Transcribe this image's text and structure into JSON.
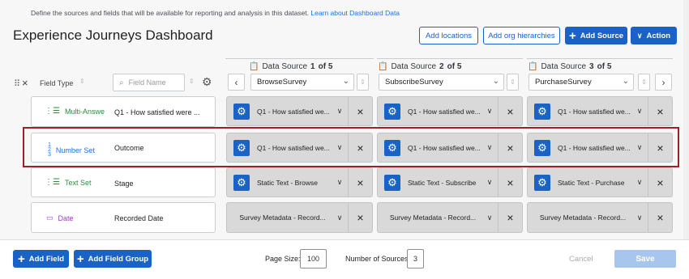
{
  "header": {
    "intro_text": "Define the sources and fields that will be available for reporting and analysis in this dataset.",
    "intro_link": "Learn about Dashboard Data",
    "title": "Experience Journeys Dashboard",
    "add_locations": "Add locations",
    "add_org_hierarchies": "Add org hierarchies",
    "add_source": "Add Source",
    "action": "Action"
  },
  "columns": {
    "field_type": "Field Type",
    "field_name_placeholder": "Field Name"
  },
  "sources": [
    {
      "label": "Data Source",
      "num": "1",
      "of": "of 5",
      "select": "BrowseSurvey"
    },
    {
      "label": "Data Source",
      "num": "2",
      "of": "of 5",
      "select": "SubscribeSurvey"
    },
    {
      "label": "Data Source",
      "num": "3",
      "of": "of 5",
      "select": "PurchaseSurvey"
    }
  ],
  "rows": [
    {
      "type": "Multi-Answe",
      "name": "Q1 - How satisfied were ...",
      "cells": [
        "Q1 - How satisfied we...",
        "Q1 - How satisfied we...",
        "Q1 - How satisfied we..."
      ]
    },
    {
      "type": "Number Set",
      "name": "Outcome",
      "cells": [
        "Q1 - How satisfied we...",
        "Q1 - How satisfied we...",
        "Q1 - How satisfied we..."
      ]
    },
    {
      "type": "Text Set",
      "name": "Stage",
      "cells": [
        "Static Text - Browse",
        "Static Text - Subscribe",
        "Static Text - Purchase"
      ]
    },
    {
      "type": "Date",
      "name": "Recorded Date",
      "cells": [
        "Survey Metadata - Record...",
        "Survey Metadata - Record...",
        "Survey Metadata - Record..."
      ]
    }
  ],
  "footer": {
    "add_field": "Add Field",
    "add_field_group": "Add Field Group",
    "page_size_label": "Page Size:",
    "page_size_value": "100",
    "num_sources_label": "Number of Sources:",
    "num_sources_value": "3",
    "cancel": "Cancel",
    "save": "Save"
  },
  "colors": {
    "accent": "#1a62c6",
    "highlight": "#a01f2b",
    "multi_answer": "#2e8b3e",
    "number_set": "#1a73e8",
    "text_set": "#2e8b3e",
    "date": "#9b3fb5"
  }
}
